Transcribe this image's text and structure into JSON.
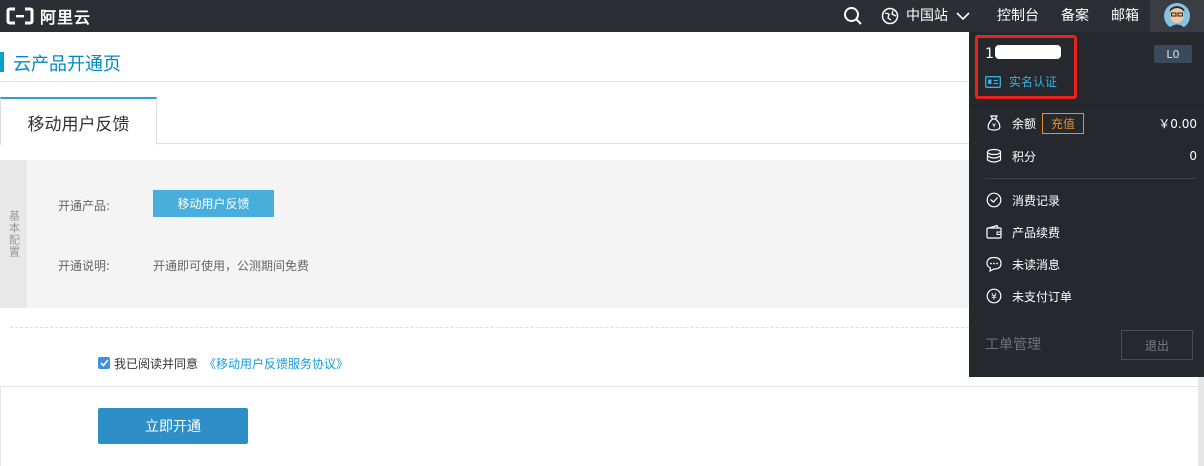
{
  "topbar": {
    "logo_text": "阿里云",
    "site_label": "中国站",
    "items": [
      "控制台",
      "备案",
      "邮箱"
    ]
  },
  "page": {
    "title": "云产品开通页",
    "tab_label": "移动用户反馈"
  },
  "config": {
    "side_label": "基本配置",
    "product_label": "开通产品:",
    "product_value": "移动用户反馈",
    "desc_label": "开通说明:",
    "desc_value": "开通即可使用，公测期间免费"
  },
  "agreement": {
    "text": "我已阅读并同意",
    "link": "《移动用户反馈服务协议》",
    "checked": true
  },
  "actions": {
    "open_label": "立即开通"
  },
  "dropdown": {
    "user_prefix": "1",
    "level": "L0",
    "verify_label": "实名认证",
    "balance_label": "余额",
    "recharge_label": "充值",
    "balance_value": "￥0.00",
    "points_label": "积分",
    "points_value": "0",
    "menu": [
      "消费记录",
      "产品续费",
      "未读消息",
      "未支付订单"
    ],
    "ticket_label": "工单管理",
    "logout_label": "退出"
  },
  "colors": {
    "topbar": "#2b2e33",
    "dropdown": "#25282d",
    "accent": "#0089c7",
    "primary_button": "#2e8fc8",
    "highlight": "#e8221c",
    "recharge": "#e8912c"
  }
}
